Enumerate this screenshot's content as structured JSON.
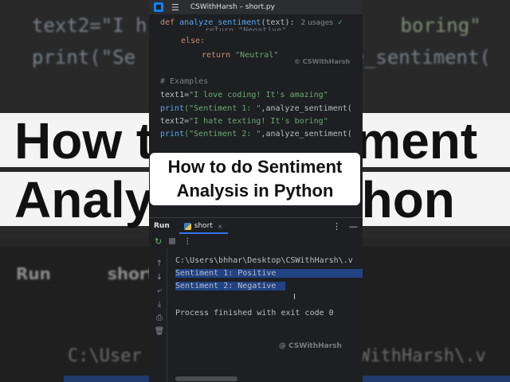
{
  "window": {
    "title": "CSWithHarsh – short.py"
  },
  "editor": {
    "def_line": {
      "keyword": "def",
      "function": "analyze_sentiment",
      "params": "(text):",
      "usages": "2 usages"
    },
    "partial_line": "return \"Negative\"",
    "else_line": "else:",
    "return_neutral": {
      "keyword": "return",
      "value": "\"Neutral\""
    },
    "watermark": "© CSWithHarsh",
    "comment": "# Examples",
    "text1": {
      "name": "text1=",
      "value": "\"I love coding! It's amazing\""
    },
    "print1": {
      "fn": "print",
      "str": "(\"Sentiment 1: \"",
      "rest": ",analyze_sentiment("
    },
    "text2": {
      "name": "text2=",
      "value": "\"I hate texting! It's boring\""
    },
    "print2": {
      "fn": "print",
      "str": "(\"Sentiment 2: \"",
      "rest": ",analyze_sentiment("
    }
  },
  "caption": {
    "line1": "How to do Sentiment",
    "line2": "Analysis in Python"
  },
  "run_panel": {
    "label": "Run",
    "tab_label": "short",
    "tab_close": "×",
    "console": {
      "path": "C:\\Users\\bhhar\\Desktop\\CSWithHarsh\\.v",
      "out1": "Sentiment 1:  Positive",
      "out2": "Sentiment 2:  Negative",
      "exit": "Process finished with exit code 0",
      "watermark": "@ CSWithHarsh"
    }
  },
  "background": {
    "code1": "text2=\"I h",
    "code1b": "boring\"",
    "code2": "print(\"Se",
    "code2b": "ze_sentiment(",
    "big1": "How t",
    "big1b": "timent",
    "big2": "Analy",
    "big2b": "thon",
    "run": "Run",
    "short": "short",
    "user": "C:\\User",
    "userb": "SWithHarsh\\.v"
  },
  "colors": {
    "keyword": "#cf8e6d",
    "function": "#56a8f5",
    "string": "#6aab73",
    "selection": "#214283",
    "accent": "#3574f0"
  }
}
